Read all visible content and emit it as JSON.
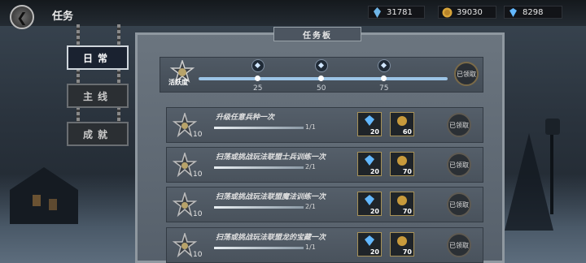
{
  "header": {
    "title": "任务"
  },
  "resources": [
    {
      "icon": "crystal-icon",
      "value": "31781"
    },
    {
      "icon": "gold-coin-icon",
      "value": "39030"
    },
    {
      "icon": "gem-icon",
      "value": "8298"
    }
  ],
  "tabs": [
    {
      "label": "日常",
      "active": true
    },
    {
      "label": "主线",
      "active": false
    },
    {
      "label": "成就",
      "active": false
    }
  ],
  "board": {
    "title": "任务板"
  },
  "activity": {
    "label": "活跃度",
    "progress_percent": 100,
    "milestones": [
      "25",
      "50",
      "75"
    ],
    "claim_label": "已领取"
  },
  "tasks": [
    {
      "title": "升级任意兵种一次",
      "level": "10",
      "progress": "1/1",
      "rewards": [
        {
          "icon": "gem-icon",
          "value": "20"
        },
        {
          "icon": "exp-coin-icon",
          "value": "60"
        }
      ],
      "claim_label": "已领取"
    },
    {
      "title": "扫荡或挑战玩法联盟士兵训练一次",
      "level": "10",
      "progress": "2/1",
      "rewards": [
        {
          "icon": "gem-icon",
          "value": "20"
        },
        {
          "icon": "exp-coin-icon",
          "value": "70"
        }
      ],
      "claim_label": "已领取"
    },
    {
      "title": "扫荡或挑战玩法联盟魔法训练一次",
      "level": "10",
      "progress": "2/1",
      "rewards": [
        {
          "icon": "gem-icon",
          "value": "20"
        },
        {
          "icon": "exp-coin-icon",
          "value": "70"
        }
      ],
      "claim_label": "已领取"
    },
    {
      "title": "扫荡或挑战玩法联盟龙的宝藏一次",
      "level": "10",
      "progress": "1/1",
      "rewards": [
        {
          "icon": "gem-icon",
          "value": "20"
        },
        {
          "icon": "exp-coin-icon",
          "value": "70"
        }
      ],
      "claim_label": "已领取"
    }
  ],
  "colors": {
    "accent": "#9cc4e6",
    "gold_border": "#a89257"
  }
}
